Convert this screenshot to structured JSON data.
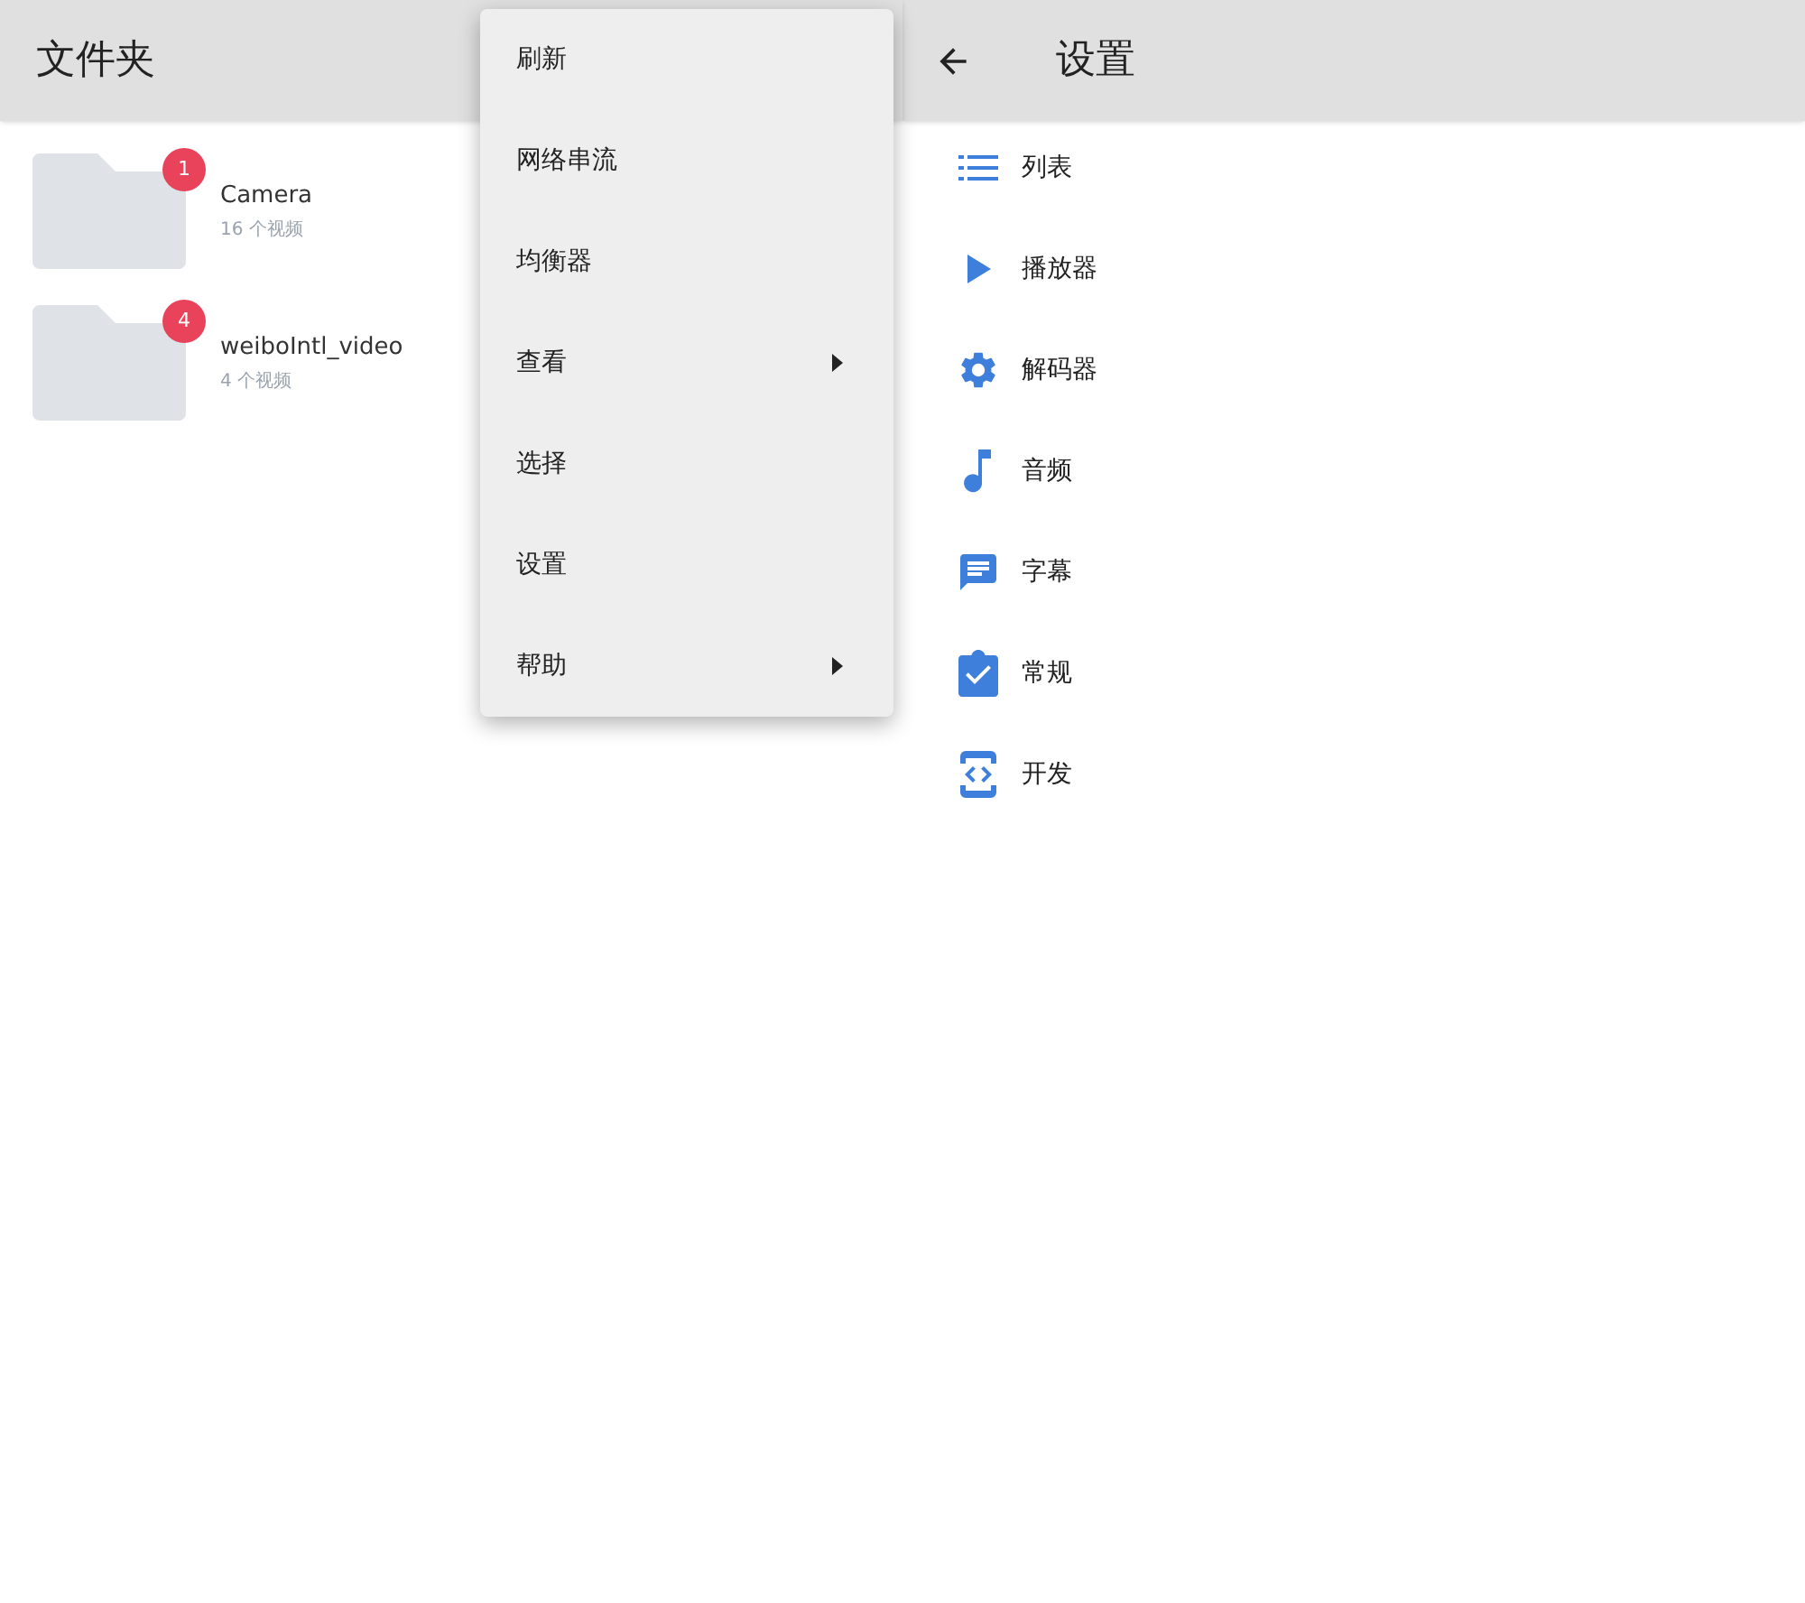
{
  "folders_panel": {
    "title": "文件夹",
    "folders": [
      {
        "name": "Camera",
        "count": "16 个视频",
        "badge": "1"
      },
      {
        "name": "weiboIntl_video",
        "count": "4 个视频",
        "badge": "4"
      }
    ]
  },
  "menu": {
    "items": [
      {
        "label": "刷新",
        "submenu": false
      },
      {
        "label": "网络串流",
        "submenu": false
      },
      {
        "label": "均衡器",
        "submenu": false
      },
      {
        "label": "查看",
        "submenu": true
      },
      {
        "label": "选择",
        "submenu": false
      },
      {
        "label": "设置",
        "submenu": false
      },
      {
        "label": "帮助",
        "submenu": true
      }
    ]
  },
  "settings_panel": {
    "title": "设置",
    "items": [
      {
        "label": "列表",
        "kind": "list"
      },
      {
        "label": "播放器",
        "kind": "play"
      },
      {
        "label": "解码器",
        "kind": "gear"
      },
      {
        "label": "音频",
        "kind": "note"
      },
      {
        "label": "字幕",
        "kind": "chat"
      },
      {
        "label": "常规",
        "kind": "clipboard"
      },
      {
        "label": "开发",
        "kind": "code"
      }
    ]
  }
}
